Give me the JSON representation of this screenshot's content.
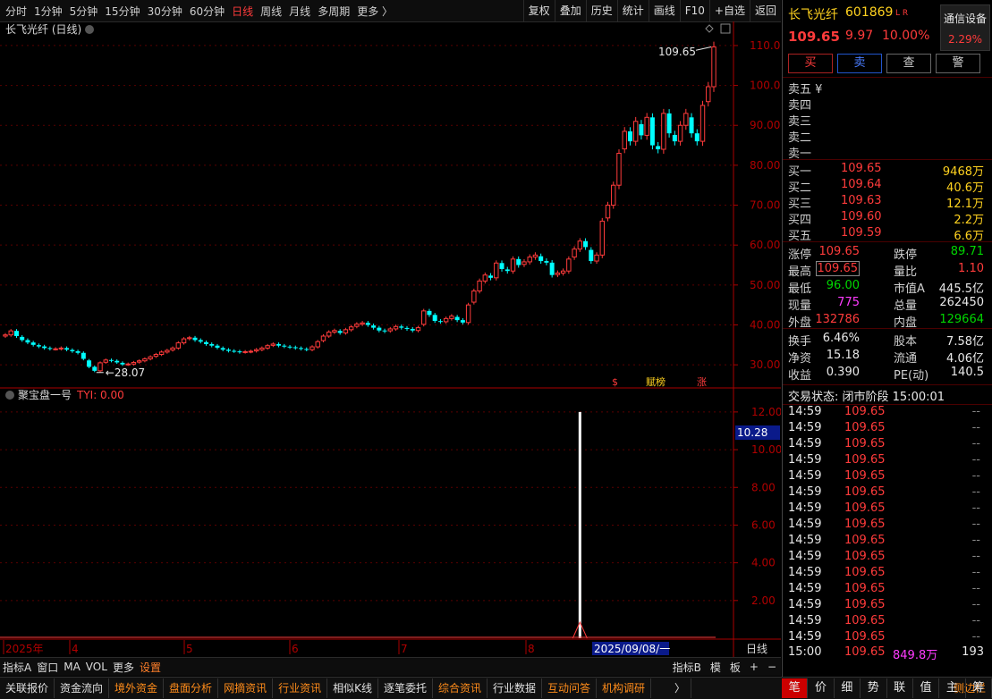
{
  "topbar": {
    "periods": [
      "分时",
      "1分钟",
      "5分钟",
      "15分钟",
      "30分钟",
      "60分钟",
      "日线",
      "周线",
      "月线",
      "多周期",
      "更多 〉"
    ],
    "active_period": "日线",
    "tools": [
      "复权",
      "叠加",
      "历史",
      "统计",
      "画线",
      "F10",
      "+自选",
      "返回"
    ]
  },
  "chart": {
    "title": "长飞光纤 (日线)",
    "high_label": "109.65",
    "low_label": "28.07",
    "markers": [
      "$",
      "赋榜",
      "涨"
    ],
    "indicator_title": "聚宝盘一号",
    "indicator_value": "TYI: 0.00",
    "indicator_current": "10.28",
    "x_labels": [
      "2025年",
      "4",
      "5",
      "6",
      "7",
      "8"
    ],
    "cursor_date": "2025/09/08/一",
    "period_label": "日线"
  },
  "chart_data": [
    {
      "type": "candlestick",
      "title": "长飞光纤 (日线)",
      "y_ticks": [
        30,
        40,
        50,
        60,
        70,
        80,
        90,
        100,
        110
      ],
      "ylim": [
        26,
        112
      ],
      "annotations": [
        {
          "label": "109.65"
        },
        {
          "label": "28.07"
        }
      ],
      "series": [
        {
          "name": "",
          "close": [
            37.5,
            38.5,
            37.2,
            36.2,
            35.6,
            35.0,
            34.6,
            34.2,
            34.0,
            34.0,
            34.2,
            33.8,
            33.4,
            33.0,
            31.5,
            29.5,
            28.5,
            30.5,
            31.2,
            31.0,
            30.6,
            30.1,
            30.2,
            30.6,
            31.0,
            31.5,
            32.0,
            32.6,
            33.2,
            33.6,
            34.2,
            35.5,
            36.5,
            36.8,
            36.2,
            35.8,
            35.2,
            34.8,
            34.3,
            33.8,
            33.5,
            33.4,
            33.2,
            33.3,
            33.4,
            33.8,
            34.2,
            34.8,
            35.2,
            34.8,
            34.6,
            34.4,
            34.2,
            34.0,
            33.8,
            34.5,
            35.8,
            37.2,
            38.2,
            38.6,
            38.0,
            38.8,
            39.5,
            40.2,
            40.5,
            40.0,
            39.3,
            38.6,
            38.4,
            39.0,
            39.6,
            39.3,
            39.0,
            38.6,
            39.3,
            43.5,
            42.5,
            41.0,
            40.8,
            41.6,
            42.2,
            41.2,
            40.6,
            45.0,
            48.5,
            51.0,
            52.5,
            51.8,
            55.5,
            54.0,
            53.5,
            56.5,
            55.0,
            55.8,
            57.0,
            57.5,
            56.0,
            55.6,
            52.5,
            53.0,
            53.5,
            56.5,
            59.0,
            61.0,
            59.5,
            56.0,
            57.5,
            66.0,
            70.0,
            75.0,
            83.0,
            88.5,
            86.0,
            91.0,
            87.5,
            92.0,
            85.0,
            84.0,
            93.0,
            88.0,
            86.0,
            90.0,
            93.0,
            88.0,
            86.0,
            95.0,
            99.68,
            109.65
          ]
        }
      ]
    },
    {
      "type": "bar",
      "title": "聚宝盘一号",
      "y_ticks": [
        2.0,
        4.0,
        6.0,
        8.0,
        10.0,
        12.0
      ],
      "ylim": [
        0,
        12.8
      ],
      "series": [
        {
          "name": "TYI",
          "spike_index": 103,
          "spike_value": 12.0,
          "last_value": 0.0
        }
      ]
    }
  ],
  "panel": {
    "name": "长飞光纤",
    "code": "601869",
    "tags": "L R",
    "device_btn": "通信设备",
    "device_pct": "2.29%",
    "price": "109.65",
    "change": "9.97",
    "change_pct": "10.00%",
    "buttons": [
      "买",
      "卖",
      "查",
      "警"
    ],
    "sell_rows": [
      {
        "label": "卖五 ¥",
        "price": "",
        "vol": ""
      },
      {
        "label": "卖四",
        "price": "",
        "vol": ""
      },
      {
        "label": "卖三",
        "price": "",
        "vol": ""
      },
      {
        "label": "卖二",
        "price": "",
        "vol": ""
      },
      {
        "label": "卖一",
        "price": "",
        "vol": ""
      }
    ],
    "buy_rows": [
      {
        "label": "买一",
        "price": "109.65",
        "vol": "9468万"
      },
      {
        "label": "买二",
        "price": "109.64",
        "vol": "40.6万"
      },
      {
        "label": "买三",
        "price": "109.63",
        "vol": "12.1万"
      },
      {
        "label": "买四",
        "price": "109.60",
        "vol": "2.2万"
      },
      {
        "label": "买五",
        "price": "109.59",
        "vol": "6.6万"
      }
    ],
    "stats1": [
      {
        "l1": "涨停",
        "v1": "109.65",
        "c1": "red",
        "l2": "跌停",
        "v2": "89.71",
        "c2": "green"
      },
      {
        "l1": "最高",
        "v1": "109.65",
        "c1": "red",
        "l2": "量比",
        "v2": "1.10",
        "c2": "red"
      },
      {
        "l1": "最低",
        "v1": "96.00",
        "c1": "green",
        "l2": "市值A",
        "v2": "445.5亿",
        "c2": "white"
      },
      {
        "l1": "现量",
        "v1": "775",
        "c1": "magenta",
        "l2": "总量",
        "v2": "262450",
        "c2": "white"
      },
      {
        "l1": "外盘",
        "v1": "132786",
        "c1": "red",
        "l2": "内盘",
        "v2": "129664",
        "c2": "green"
      }
    ],
    "stats2": [
      {
        "l1": "换手",
        "v1": "6.46%",
        "l2": "股本",
        "v2": "7.58亿"
      },
      {
        "l1": "净资",
        "v1": "15.18",
        "l2": "流通",
        "v2": "4.06亿"
      },
      {
        "l1": "收益",
        "v1": "0.390",
        "l2": "PE(动)",
        "v2": "140.5"
      }
    ],
    "trade_status": "交易状态: 闭市阶段 15:00:01",
    "ticks": [
      {
        "t": "14:59",
        "p": "109.65",
        "v": "--"
      },
      {
        "t": "14:59",
        "p": "109.65",
        "v": "--"
      },
      {
        "t": "14:59",
        "p": "109.65",
        "v": "--"
      },
      {
        "t": "14:59",
        "p": "109.65",
        "v": "--"
      },
      {
        "t": "14:59",
        "p": "109.65",
        "v": "--"
      },
      {
        "t": "14:59",
        "p": "109.65",
        "v": "--"
      },
      {
        "t": "14:59",
        "p": "109.65",
        "v": "--"
      },
      {
        "t": "14:59",
        "p": "109.65",
        "v": "--"
      },
      {
        "t": "14:59",
        "p": "109.65",
        "v": "--"
      },
      {
        "t": "14:59",
        "p": "109.65",
        "v": "--"
      },
      {
        "t": "14:59",
        "p": "109.65",
        "v": "--"
      },
      {
        "t": "14:59",
        "p": "109.65",
        "v": "--"
      },
      {
        "t": "14:59",
        "p": "109.65",
        "v": "--"
      },
      {
        "t": "14:59",
        "p": "109.65",
        "v": "--"
      },
      {
        "t": "14:59",
        "p": "109.65",
        "v": "--"
      }
    ],
    "last_tick": {
      "t": "15:00",
      "p": "109.65",
      "amt": "849.8万",
      "v": "193"
    },
    "tabs": [
      "笔",
      "价",
      "细",
      "势",
      "联",
      "值",
      "主",
      "筹"
    ]
  },
  "indicator_tabs": [
    "指标A",
    "窗口",
    "MA",
    "VOL",
    "更多",
    "设置"
  ],
  "indicator_right": [
    "指标B",
    "模",
    "板",
    "+",
    "−"
  ],
  "bottom_tabs": [
    "关联报价",
    "资金流向",
    "境外资金",
    "盘面分析",
    "网摘资讯",
    "行业资讯",
    "相似K线",
    "逐笔委托",
    "综合资讯",
    "行业数据",
    "互动问答",
    "机构调研",
    "〉",
    "侧边栏"
  ],
  "bottom_orange": [
    "境外资金",
    "盘面分析",
    "网摘资讯",
    "行业资讯",
    "综合资讯",
    "互动问答",
    "机构调研",
    "侧边栏"
  ]
}
